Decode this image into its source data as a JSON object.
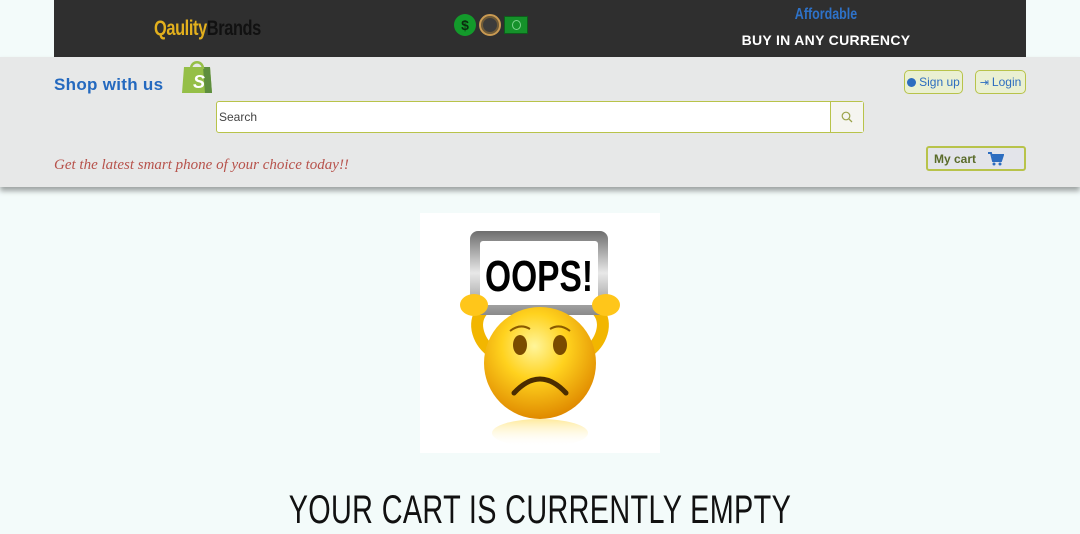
{
  "banner": {
    "brand_first": "Qaulity",
    "brand_second": "Brands",
    "affordable": "Affordable",
    "currency_text": "BUY IN ANY CURRENCY",
    "icons": [
      "dollar-coin-icon",
      "gold-coin-icon",
      "banknote-icon"
    ]
  },
  "header": {
    "shop_title": "Shop with us",
    "signup_label": "Sign up",
    "login_label": "Login",
    "tagline": "Get the latest smart phone of your choice today!!",
    "cart_label": "My cart"
  },
  "search": {
    "placeholder": "Search",
    "value": ""
  },
  "main": {
    "sign_text": "OOPS!",
    "empty_message": "YOUR CART IS CURRENTLY EMPTY"
  },
  "colors": {
    "banner_bg": "#2f2f2f",
    "brand_accent": "#e3b01d",
    "link_blue": "#2e72c8",
    "olive_border": "#b8c34a",
    "tagline_red": "#b7524b",
    "page_bg": "#f3fbfa"
  }
}
